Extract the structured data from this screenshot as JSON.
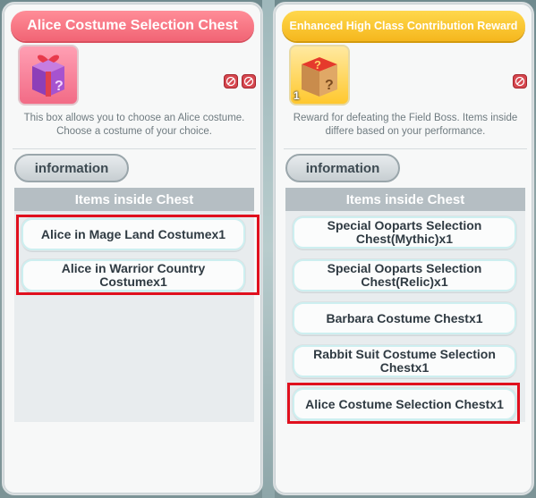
{
  "left_panel": {
    "title": "Alice Costume Selection Chest",
    "description": "This box allows you to choose an Alice costume. Choose a costume of your choice.",
    "info_button_label": "information",
    "section_header": "Items inside Chest",
    "items": [
      {
        "label": "Alice in Mage Land Costumex1"
      },
      {
        "label": "Alice in Warrior Country Costumex1"
      }
    ],
    "icon": "purple-gift-box-icon",
    "status_icons": [
      "no-trade-icon",
      "no-sell-icon"
    ]
  },
  "right_panel": {
    "title": "Enhanced High Class Contribution Reward",
    "description": "Reward for defeating the Field Boss. Items inside differe based on your performance.",
    "info_button_label": "information",
    "section_header": "Items inside Chest",
    "item_count": "1",
    "items": [
      {
        "label": "Special Ooparts Selection Chest(Mythic)x1"
      },
      {
        "label": "Special Ooparts Selection Chest(Relic)x1"
      },
      {
        "label": "Barbara Costume Chestx1"
      },
      {
        "label": "Rabbit Suit Costume Selection Chestx1"
      },
      {
        "label": "Alice Costume Selection Chestx1"
      }
    ],
    "icon": "mystery-box-icon",
    "status_icons": [
      "no-sell-icon"
    ]
  },
  "colors": {
    "title_pink": "#f16474",
    "title_gold": "#f5b71d",
    "highlight_red": "#e0101e",
    "section_header": "#b5bec3"
  }
}
